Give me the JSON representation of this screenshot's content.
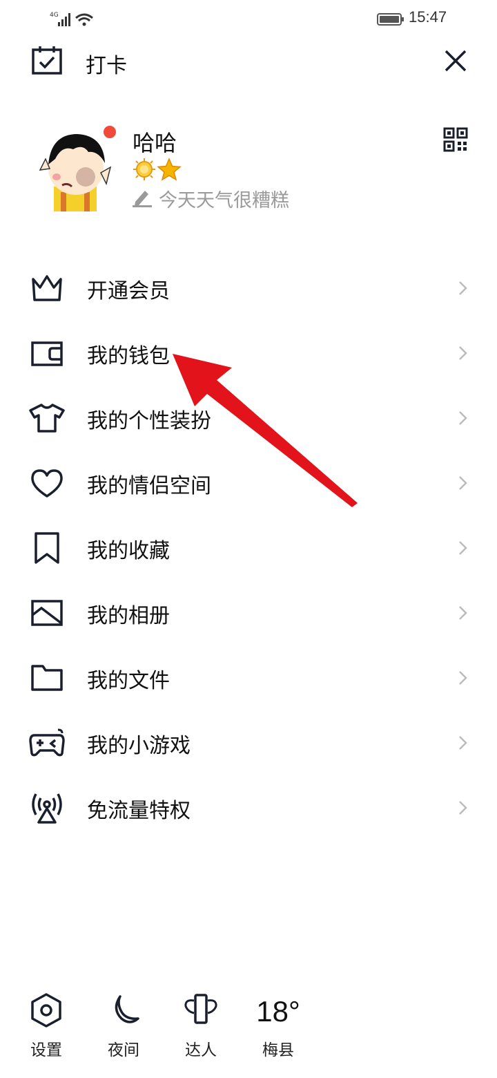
{
  "status_bar": {
    "network": "4G",
    "time": "15:47"
  },
  "top_bar": {
    "checkin_label": "打卡"
  },
  "profile": {
    "name": "哈哈",
    "signature": "今天天气很糟糕"
  },
  "menu": {
    "items": [
      {
        "label": "开通会员",
        "icon": "crown-icon"
      },
      {
        "label": "我的钱包",
        "icon": "wallet-icon"
      },
      {
        "label": "我的个性装扮",
        "icon": "tshirt-icon"
      },
      {
        "label": "我的情侣空间",
        "icon": "heart-icon"
      },
      {
        "label": "我的收藏",
        "icon": "bookmark-icon"
      },
      {
        "label": "我的相册",
        "icon": "photo-icon"
      },
      {
        "label": "我的文件",
        "icon": "folder-icon"
      },
      {
        "label": "我的小游戏",
        "icon": "gamepad-icon"
      },
      {
        "label": "免流量特权",
        "icon": "broadcast-tower-icon"
      }
    ]
  },
  "bottom_bar": {
    "settings_label": "设置",
    "night_label": "夜间",
    "expert_label": "达人",
    "weather_temp": "18°",
    "weather_city": "梅县"
  },
  "colors": {
    "accent_red": "#ef4a3a",
    "annotation_red": "#e3131c",
    "icon_dark": "#1a1f2e",
    "muted_gray": "#9a9a9a",
    "star_gold": "#f5b400"
  }
}
